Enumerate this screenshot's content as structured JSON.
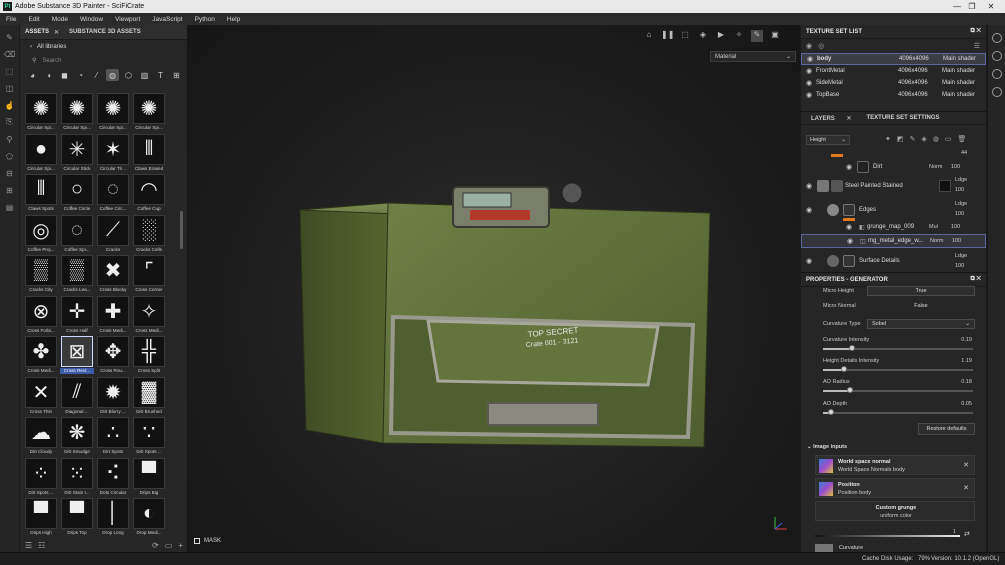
{
  "window": {
    "title": "Adobe Substance 3D Painter - SciFiCrate",
    "app_icon_text": "Pt"
  },
  "menu": [
    "File",
    "Edit",
    "Mode",
    "Window",
    "Viewport",
    "JavaScript",
    "Python",
    "Help"
  ],
  "assets": {
    "tab_assets": "ASSETS",
    "tab_substance": "SUBSTANCE 3D ASSETS",
    "libraries": "All libraries",
    "search_placeholder": "Search",
    "items": [
      {
        "label": "Circular Spi...",
        "glyph": "✺"
      },
      {
        "label": "Circular Spi...",
        "glyph": "✺"
      },
      {
        "label": "Circular Spi...",
        "glyph": "✺"
      },
      {
        "label": "Circular Spi...",
        "glyph": "✺"
      },
      {
        "label": "Circular Spi...",
        "glyph": "●"
      },
      {
        "label": "Circular Stick",
        "glyph": "✳"
      },
      {
        "label": "Circular Tri...",
        "glyph": "✶"
      },
      {
        "label": "Claws Erased",
        "glyph": "⦀"
      },
      {
        "label": "Claws Spots",
        "glyph": "⦀"
      },
      {
        "label": "Coffee Circle",
        "glyph": "○"
      },
      {
        "label": "Coffee Circ...",
        "glyph": "◌"
      },
      {
        "label": "Coffee Cup",
        "glyph": "◠"
      },
      {
        "label": "Coffee Proj...",
        "glyph": "◎"
      },
      {
        "label": "Coffee Spi...",
        "glyph": "◌"
      },
      {
        "label": "Cracks",
        "glyph": "⟋"
      },
      {
        "label": "Cracks Cells",
        "glyph": "░"
      },
      {
        "label": "Cracks City",
        "glyph": "▒"
      },
      {
        "label": "Cracks Lea...",
        "glyph": "▒"
      },
      {
        "label": "Cross Blocky",
        "glyph": "✖"
      },
      {
        "label": "Cross Corner",
        "glyph": "⌜"
      },
      {
        "label": "Cross Forbi...",
        "glyph": "⊗"
      },
      {
        "label": "Cross Half",
        "glyph": "✛"
      },
      {
        "label": "Cross Medi...",
        "glyph": "✚"
      },
      {
        "label": "Cross Medi...",
        "glyph": "✧"
      },
      {
        "label": "Cross Medi...",
        "glyph": "✤"
      },
      {
        "label": "Cross Rect...",
        "glyph": "⊠"
      },
      {
        "label": "Cross Rou...",
        "glyph": "✥"
      },
      {
        "label": "Cross Split",
        "glyph": "╬"
      },
      {
        "label": "Cross Thin",
        "glyph": "✕"
      },
      {
        "label": "Diagonal ...",
        "glyph": "⫽"
      },
      {
        "label": "Dirt Blurry ...",
        "glyph": "✹"
      },
      {
        "label": "Dirt Brushed",
        "glyph": "▓"
      },
      {
        "label": "Dirt Cloudy",
        "glyph": "☁"
      },
      {
        "label": "Dirt Smudge",
        "glyph": "❋"
      },
      {
        "label": "Dirt Spots",
        "glyph": "∴"
      },
      {
        "label": "Dirt Spots ...",
        "glyph": "∵"
      },
      {
        "label": "Dirt Spots ...",
        "glyph": "⁘"
      },
      {
        "label": "Dirt Stain I...",
        "glyph": "⁙"
      },
      {
        "label": "Dots Circular",
        "glyph": "⠪"
      },
      {
        "label": "Drips Big",
        "glyph": "▀"
      },
      {
        "label": "Drips High",
        "glyph": "▀"
      },
      {
        "label": "Drips Top",
        "glyph": "▀"
      },
      {
        "label": "Drop Long",
        "glyph": "│"
      },
      {
        "label": "Drop Medi...",
        "glyph": "◐"
      }
    ]
  },
  "viewport": {
    "material": "Material",
    "mask_label": "MASK",
    "crate_text_1": "TOP SECRET",
    "crate_text_2": "Crate 001 - 3121"
  },
  "texture_set_list": {
    "title": "TEXTURE SET LIST",
    "rows": [
      {
        "name": "body",
        "res": "4096x4096",
        "shader": "Main shader"
      },
      {
        "name": "FrontMetal",
        "res": "4096x4096",
        "shader": "Main shader"
      },
      {
        "name": "SideMetal",
        "res": "4096x4096",
        "shader": "Main shader"
      },
      {
        "name": "TopBase",
        "res": "4096x4096",
        "shader": "Main shader"
      }
    ]
  },
  "layers": {
    "tab_layers": "LAYERS",
    "tab_tss": "TEXTURE SET SETTINGS",
    "channel": "Height",
    "top_value": "44",
    "rows": [
      {
        "name": "Dirt",
        "blend": "Norm",
        "opacity": "100"
      },
      {
        "name": "Steel Painted Stained",
        "blend": "Ldge",
        "opacity": "100"
      },
      {
        "name": "Edges",
        "blend": "Ldge",
        "opacity": "100"
      },
      {
        "name": "grunge_map_009",
        "blend": "Mul",
        "opacity": "100"
      },
      {
        "name": "mg_metal_edge_w...",
        "blend": "Norm",
        "opacity": "100"
      },
      {
        "name": "Surface Details",
        "blend": "Ldge",
        "opacity": "100"
      }
    ]
  },
  "properties": {
    "title": "PROPERTIES - GENERATOR",
    "micro_height": "Micro Height",
    "micro_height_val": "True",
    "micro_normal": "Micro Normal",
    "micro_normal_val": "False",
    "curvature_type": "Curvature Type",
    "curvature_type_val": "Sobel",
    "sliders": [
      {
        "label": "Curvature Intensity",
        "value": "0.19",
        "fraction": 0.19
      },
      {
        "label": "Height Details Intensity",
        "value": "1.19",
        "fraction": 0.14
      },
      {
        "label": "AO Radius",
        "value": "0.18",
        "fraction": 0.18
      },
      {
        "label": "AO Depth",
        "value": "0.05",
        "fraction": 0.05
      }
    ],
    "restore": "Restore defaults",
    "image_inputs": "Image inputs",
    "inputs": [
      {
        "title": "World space normal",
        "sub": "World Space Normals body"
      },
      {
        "title": "Position",
        "sub": "Position body"
      }
    ],
    "custom_grunge": "Custom grunge",
    "uniform_color": "uniform color",
    "grunge_value": "1",
    "curvature": "Curvature"
  },
  "status": {
    "cache": "Cache Disk Usage:",
    "cache_val": "79%",
    "version": "Version: 10.1.2 (OpenGL)"
  },
  "colors": {
    "accent": "#5a6aa0",
    "layer_orange": "#e07a1a"
  }
}
